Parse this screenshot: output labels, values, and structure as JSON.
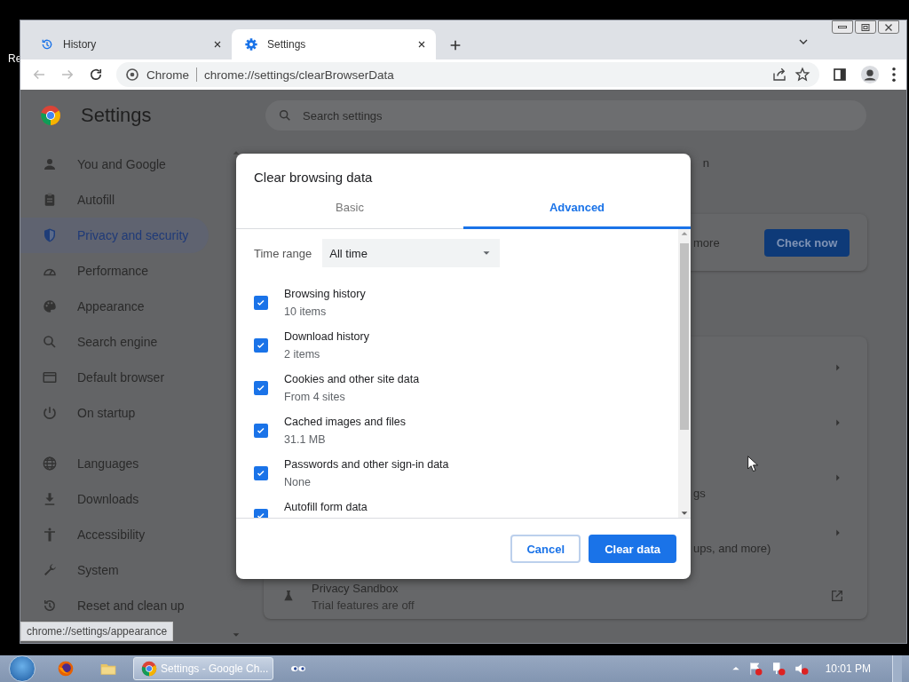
{
  "desktop": {
    "icon_label": "Re"
  },
  "browser": {
    "tabs": [
      {
        "title": "History",
        "kind": "history",
        "selected": false
      },
      {
        "title": "Settings",
        "kind": "gear",
        "selected": true
      }
    ],
    "omnibox": {
      "chip": "Chrome",
      "url": "chrome://settings/clearBrowserData"
    }
  },
  "settings": {
    "title": "Settings",
    "search_placeholder": "Search settings",
    "nav_groups": [
      [
        {
          "label": "You and Google",
          "kind": "person",
          "selected": false
        },
        {
          "label": "Autofill",
          "kind": "clipboard",
          "selected": false
        },
        {
          "label": "Privacy and security",
          "kind": "shield",
          "selected": true
        },
        {
          "label": "Performance",
          "kind": "gauge",
          "selected": false
        },
        {
          "label": "Appearance",
          "kind": "palette",
          "selected": false
        },
        {
          "label": "Search engine",
          "kind": "search",
          "selected": false
        },
        {
          "label": "Default browser",
          "kind": "browser",
          "selected": false
        },
        {
          "label": "On startup",
          "kind": "power",
          "selected": false
        }
      ],
      [
        {
          "label": "Languages",
          "kind": "globe",
          "selected": false
        },
        {
          "label": "Downloads",
          "kind": "download",
          "selected": false
        },
        {
          "label": "Accessibility",
          "kind": "accessibility",
          "selected": false
        },
        {
          "label": "System",
          "kind": "wrench",
          "selected": false
        },
        {
          "label": "Reset and clean up",
          "kind": "reset",
          "selected": false
        }
      ]
    ],
    "status_bubble": "chrome://settings/appearance",
    "main": {
      "partial_heading": "n",
      "safety_card": {
        "text": "more",
        "button": "Check now"
      },
      "privacy_rows": [
        {
          "kind": "arrow"
        },
        {
          "kind": "arrow"
        },
        {
          "kind": "arrow",
          "text": "gs"
        },
        {
          "kind": "arrow",
          "text": "ups, and more)"
        },
        {
          "kind": "external",
          "title": "Privacy Sandbox",
          "subtitle": "Trial features are off"
        }
      ]
    }
  },
  "dialog": {
    "title": "Clear browsing data",
    "tabs": [
      {
        "label": "Basic",
        "selected": false
      },
      {
        "label": "Advanced",
        "selected": true
      }
    ],
    "time_range": {
      "label": "Time range",
      "value": "All time"
    },
    "items": [
      {
        "label": "Browsing history",
        "detail": "10 items",
        "checked": true
      },
      {
        "label": "Download history",
        "detail": "2 items",
        "checked": true
      },
      {
        "label": "Cookies and other site data",
        "detail": "From 4 sites",
        "checked": true
      },
      {
        "label": "Cached images and files",
        "detail": "31.1 MB",
        "checked": true
      },
      {
        "label": "Passwords and other sign-in data",
        "detail": "None",
        "checked": true
      },
      {
        "label": "Autofill form data",
        "checked": true
      }
    ],
    "buttons": [
      {
        "label": "Cancel",
        "kind": "secondary"
      },
      {
        "label": "Clear data",
        "kind": "primary"
      }
    ]
  },
  "taskbar": {
    "apps": [
      {
        "kind": "firefox",
        "selected": false
      },
      {
        "kind": "folder",
        "selected": false
      },
      {
        "kind": "chrome",
        "label": "Settings - Google Ch...",
        "selected": true
      },
      {
        "kind": "eyes",
        "selected": false
      }
    ],
    "clock": "10:01 PM"
  }
}
